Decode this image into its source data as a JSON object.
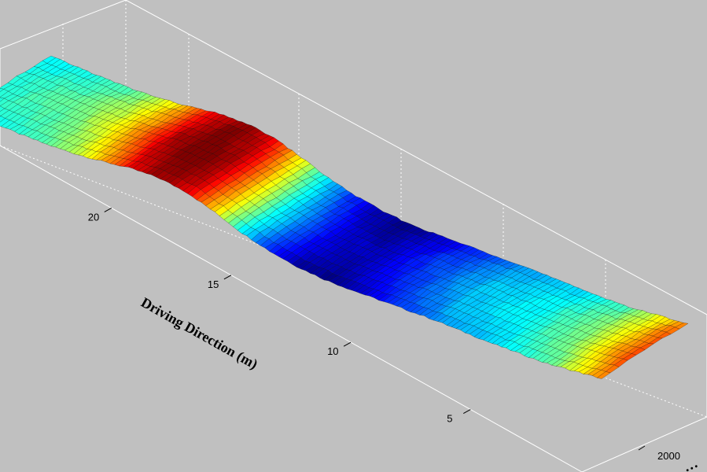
{
  "chart_data": {
    "type": "surface",
    "title": "",
    "colormap": "jet",
    "grid": true,
    "x_axis": {
      "label": "Driving Direction (m)",
      "ticks": [
        5,
        10,
        15,
        20
      ],
      "range": [
        1,
        24
      ]
    },
    "y_axis": {
      "label": "…",
      "ticks": [
        2000
      ],
      "partially_visible": true
    },
    "surface_profile": {
      "description_values": "approximate relative elevation along driving direction (0 = lowest, 1 = highest)",
      "x": [
        1,
        3,
        5,
        7,
        9,
        10,
        11,
        12,
        13,
        14,
        15,
        16,
        17,
        18,
        19,
        20,
        21,
        22,
        23,
        24
      ],
      "z": [
        0.75,
        0.45,
        0.32,
        0.26,
        0.12,
        0.05,
        0.0,
        0.03,
        0.15,
        0.35,
        0.65,
        0.9,
        0.97,
        0.88,
        0.7,
        0.55,
        0.45,
        0.4,
        0.38,
        0.35
      ]
    },
    "colors": {
      "background": "#c0c0c0",
      "box_lines": "#ffffff",
      "grid_lines": "#ffffff",
      "mesh_lines": "#000000"
    }
  }
}
